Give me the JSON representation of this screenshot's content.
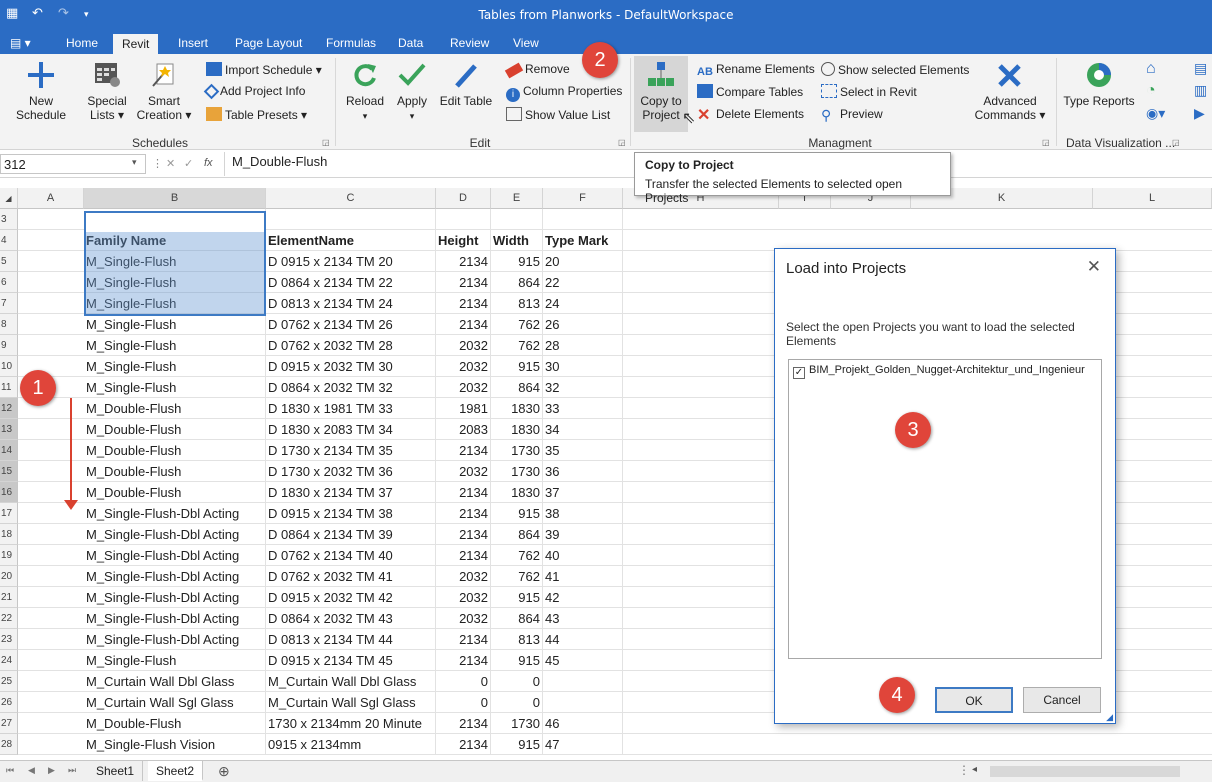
{
  "window": {
    "title": "Tables from Planworks - DefaultWorkspace"
  },
  "tabs": [
    "Home",
    "Revit",
    "Insert",
    "Page Layout",
    "Formulas",
    "Data",
    "Review",
    "View"
  ],
  "active_tab": "Revit",
  "ribbon": {
    "schedules": {
      "label": "Schedules",
      "new_schedule": "New Schedule",
      "special_lists": "Special",
      "special_lists2": "Lists ▾",
      "smart_creation": "Smart",
      "smart_creation2": "Creation ▾",
      "import_schedule": "Import Schedule ▾",
      "add_project_info": "Add Project Info",
      "table_presets": "Table Presets ▾"
    },
    "edit": {
      "label": "Edit",
      "reload": "Reload",
      "apply": "Apply",
      "edit_table": "Edit Table",
      "remove": "Remove",
      "column_properties": "Column Properties",
      "show_value_list": "Show Value List"
    },
    "management": {
      "label": "Managment",
      "copy_to_project": "Copy to",
      "copy_to_project2": "Project",
      "rename_elements": "Rename Elements",
      "compare_tables": "Compare Tables",
      "delete_elements": "Delete Elements",
      "show_selected": "Show selected Elements",
      "select_in_revit": "Select in Revit",
      "preview": "Preview",
      "advanced_commands": "Advanced",
      "advanced_commands2": "Commands ▾"
    },
    "data_viz": {
      "label": "Data Visualization ...",
      "type_reports": "Type Reports"
    }
  },
  "formula_bar": {
    "name_box": "312",
    "fx": "fx",
    "value": "M_Double-Flush"
  },
  "tooltip": {
    "title": "Copy to Project",
    "desc": "Transfer the selected Elements to selected open Projects"
  },
  "columns": [
    "A",
    "B",
    "C",
    "D",
    "E",
    "F",
    "H",
    "I",
    "J",
    "K",
    "L"
  ],
  "rows": [
    {
      "n": "3",
      "b": "",
      "c": "",
      "d": "",
      "e": "",
      "f": ""
    },
    {
      "n": "4",
      "b": "Family Name",
      "c": "ElementName",
      "d": "Height",
      "e": "Width",
      "f": "Type Mark",
      "hdr": true
    },
    {
      "n": "5",
      "b": "M_Single-Flush",
      "c": "D 0915 x 2134 TM 20",
      "d": "2134",
      "e": "915",
      "f": "20"
    },
    {
      "n": "6",
      "b": "M_Single-Flush",
      "c": "D 0864 x 2134 TM 22",
      "d": "2134",
      "e": "864",
      "f": "22"
    },
    {
      "n": "7",
      "b": "M_Single-Flush",
      "c": "D 0813 x 2134 TM 24",
      "d": "2134",
      "e": "813",
      "f": "24"
    },
    {
      "n": "8",
      "b": "M_Single-Flush",
      "c": "D 0762 x 2134 TM 26",
      "d": "2134",
      "e": "762",
      "f": "26"
    },
    {
      "n": "9",
      "b": "M_Single-Flush",
      "c": "D 0762 x 2032 TM 28",
      "d": "2032",
      "e": "762",
      "f": "28"
    },
    {
      "n": "10",
      "b": "M_Single-Flush",
      "c": "D 0915 x 2032 TM 30",
      "d": "2032",
      "e": "915",
      "f": "30"
    },
    {
      "n": "11",
      "b": "M_Single-Flush",
      "c": "D 0864 x 2032 TM 32",
      "d": "2032",
      "e": "864",
      "f": "32"
    },
    {
      "n": "12",
      "b": "M_Double-Flush",
      "c": "D 1830 x 1981 TM 33",
      "d": "1981",
      "e": "1830",
      "f": "33",
      "sel": true
    },
    {
      "n": "13",
      "b": "M_Double-Flush",
      "c": "D 1830 x 2083 TM 34",
      "d": "2083",
      "e": "1830",
      "f": "34",
      "sel": true
    },
    {
      "n": "14",
      "b": "M_Double-Flush",
      "c": "D 1730 x 2134 TM 35",
      "d": "2134",
      "e": "1730",
      "f": "35",
      "sel": true
    },
    {
      "n": "15",
      "b": "M_Double-Flush",
      "c": "D 1730 x 2032 TM 36",
      "d": "2032",
      "e": "1730",
      "f": "36",
      "sel": true
    },
    {
      "n": "16",
      "b": "M_Double-Flush",
      "c": "D 1830 x 2134 TM 37",
      "d": "2134",
      "e": "1830",
      "f": "37",
      "sel": true
    },
    {
      "n": "17",
      "b": "M_Single-Flush-Dbl Acting",
      "c": "D 0915 x 2134 TM 38",
      "d": "2134",
      "e": "915",
      "f": "38"
    },
    {
      "n": "18",
      "b": "M_Single-Flush-Dbl Acting",
      "c": "D 0864 x 2134 TM 39",
      "d": "2134",
      "e": "864",
      "f": "39"
    },
    {
      "n": "19",
      "b": "M_Single-Flush-Dbl Acting",
      "c": "D 0762 x 2134 TM 40",
      "d": "2134",
      "e": "762",
      "f": "40"
    },
    {
      "n": "20",
      "b": "M_Single-Flush-Dbl Acting",
      "c": "D 0762 x 2032 TM 41",
      "d": "2032",
      "e": "762",
      "f": "41"
    },
    {
      "n": "21",
      "b": "M_Single-Flush-Dbl Acting",
      "c": "D 0915 x 2032 TM 42",
      "d": "2032",
      "e": "915",
      "f": "42"
    },
    {
      "n": "22",
      "b": "M_Single-Flush-Dbl Acting",
      "c": "D 0864 x 2032 TM 43",
      "d": "2032",
      "e": "864",
      "f": "43"
    },
    {
      "n": "23",
      "b": "M_Single-Flush-Dbl Acting",
      "c": "D 0813 x 2134 TM 44",
      "d": "2134",
      "e": "813",
      "f": "44"
    },
    {
      "n": "24",
      "b": "M_Single-Flush",
      "c": "D 0915 x 2134 TM 45",
      "d": "2134",
      "e": "915",
      "f": "45"
    },
    {
      "n": "25",
      "b": "M_Curtain Wall Dbl Glass",
      "c": "M_Curtain Wall Dbl Glass",
      "d": "0",
      "e": "0",
      "f": ""
    },
    {
      "n": "26",
      "b": "M_Curtain Wall Sgl Glass",
      "c": "M_Curtain Wall Sgl Glass",
      "d": "0",
      "e": "0",
      "f": ""
    },
    {
      "n": "27",
      "b": "M_Double-Flush",
      "c": "1730 x 2134mm 20 Minute",
      "d": "2134",
      "e": "1730",
      "f": "46"
    },
    {
      "n": "28",
      "b": "M_Single-Flush Vision",
      "c": "0915 x 2134mm",
      "d": "2134",
      "e": "915",
      "f": "47"
    }
  ],
  "dialog": {
    "title": "Load into Projects",
    "close": "✕",
    "message": "Select the open Projects you want to load the selected Elements",
    "project": "BIM_Projekt_Golden_Nugget-Architektur_und_Ingenieur",
    "ok": "OK",
    "cancel": "Cancel"
  },
  "sheets": [
    "Sheet1",
    "Sheet2"
  ],
  "active_sheet": "Sheet2",
  "badges": [
    "1",
    "2",
    "3",
    "4"
  ],
  "colors": {
    "accent": "#2b6cc4",
    "badge": "#e0453a",
    "selection": "#a9c4e6"
  }
}
